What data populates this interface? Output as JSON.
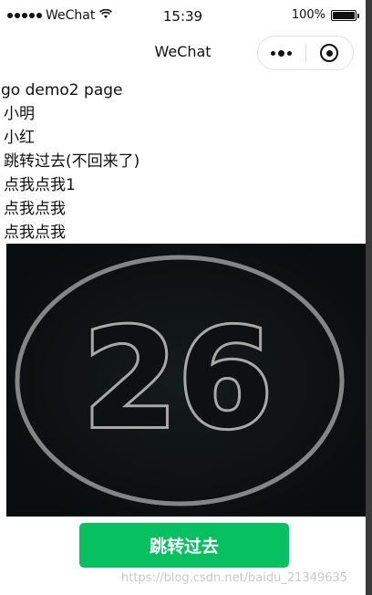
{
  "status_bar": {
    "carrier": "WeChat",
    "time": "15:39",
    "battery": "100%",
    "battery_level": 1.0
  },
  "nav": {
    "title": "WeChat"
  },
  "content": {
    "lines": [
      "go demo2 page",
      "小明",
      "小红",
      "跳转过去(不回来了)",
      "点我点我1",
      "点我点我",
      "点我点我"
    ]
  },
  "image": {
    "number": "26"
  },
  "button": {
    "label": "跳转过去"
  },
  "watermark": "https://blog.csdn.net/baidu_21349635",
  "colors": {
    "button": "#07c160",
    "image_background": "#0d1113"
  }
}
